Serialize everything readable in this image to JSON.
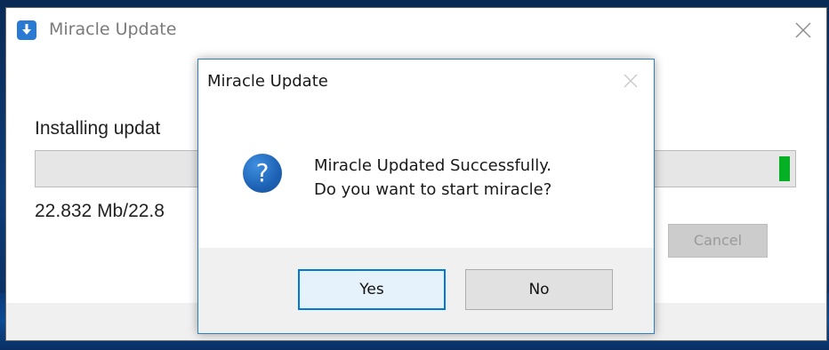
{
  "main_window": {
    "title": "Miracle Update",
    "installing_text": "Installing updat",
    "progress": 0.99,
    "size_text": "22.832 Mb/22.8",
    "cancel_label": "Cancel",
    "app_icon": "download-icon",
    "close_icon": "close-icon"
  },
  "dialog": {
    "title": "Miracle Update",
    "message_line1": "Miracle Updated Successfully.",
    "message_line2": "Do you want to start miracle?",
    "question_glyph": "?",
    "icon": "question-icon",
    "close_icon": "close-icon",
    "yes_label": "Yes",
    "no_label": "No"
  },
  "colors": {
    "accent": "#0078d7",
    "progress_green": "#06b025",
    "app_icon_blue": "#2a7ad4"
  }
}
